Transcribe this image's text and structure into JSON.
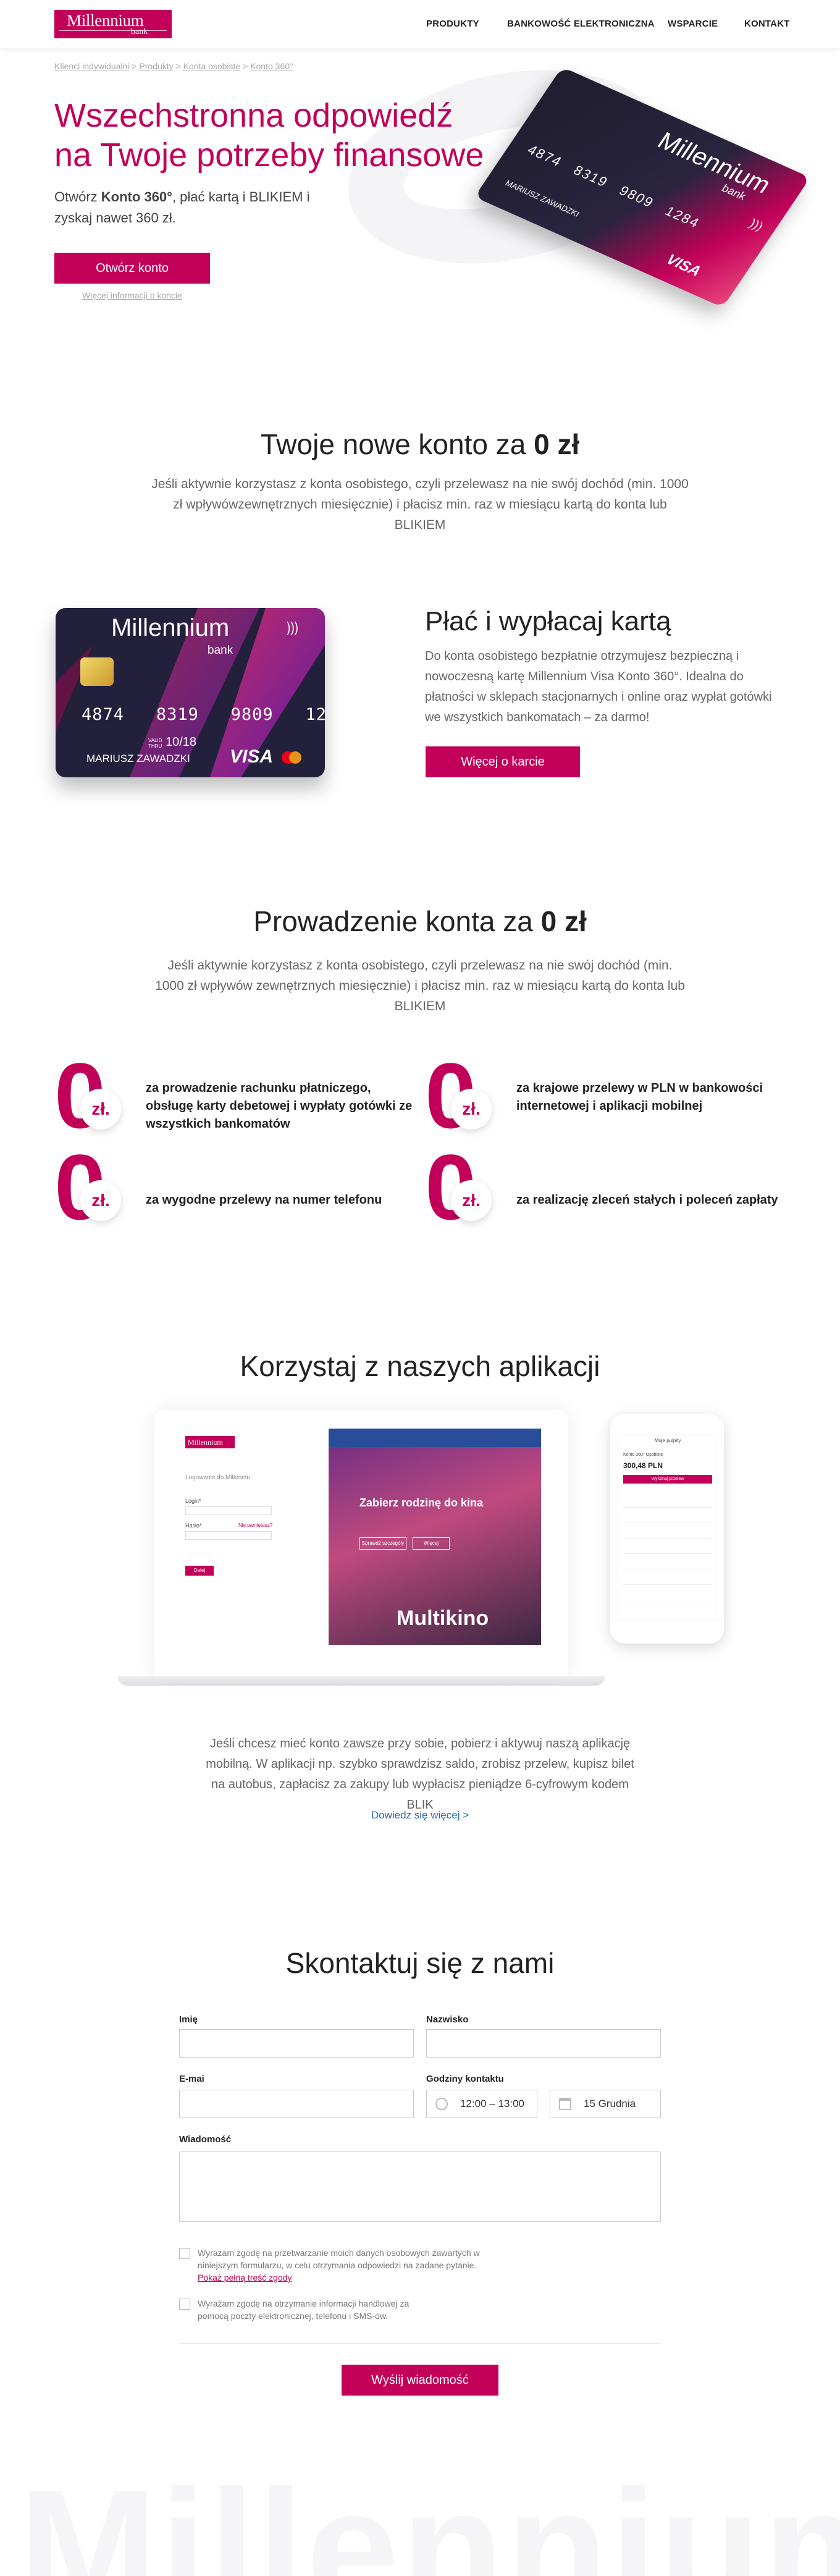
{
  "logo": {
    "name": "Millennium",
    "sub": "bank"
  },
  "nav": {
    "products": "PRODUKTY",
    "ebanking": "BANKOWOŚĆ ELEKTRONICZNA",
    "support": "WSPARCIE",
    "contact": "KONTAKT"
  },
  "breadcrumb": {
    "items": [
      "Klienci indywidualni",
      "Produkty",
      "Konta osobiste",
      "Konto 360°"
    ],
    "sep": " > "
  },
  "hero": {
    "title": "Wszechstronna odpowiedź na Twoje potrzeby finansowe",
    "sub_pre": "Otwórz ",
    "sub_bold": "Konto 360°",
    "sub_post": ", płać kartą i BLIKIEM i zyskaj nawet 360 zł.",
    "cta": "Otwórz konto",
    "more_link": "Więcej informacji o koncie"
  },
  "card": {
    "brand": "Millennium",
    "brand_sub": "bank",
    "number": [
      "4874",
      "8319",
      "9809",
      "1284"
    ],
    "valid_label": "VALID THRU",
    "valid": "10/18",
    "holder": "MARIUSZ ZAWADZKI",
    "network": "VISA"
  },
  "new_account": {
    "title_pre": "Twoje nowe konto za ",
    "title_bold": "0 zł",
    "text": "Jeśli aktywnie korzystasz z konta osobistego, czyli przelewasz na nie swój dochód (min. 1000 zł wpływówzewnętrznych miesięcznie) i płacisz min. raz w miesiącu kartą do konta lub BLIKIEM"
  },
  "pay": {
    "title": "Płać i wypłacaj kartą",
    "text": "Do konta osobistego bezpłatnie otrzymujesz bezpieczną i nowoczesną kartę Millennium Visa Konto 360°. Idealna do płatności w sklepach stacjonarnych i online oraz wypłat gotówki we wszystkich bankomatach – za darmo!",
    "cta": "Więcej o karcie"
  },
  "management": {
    "title_pre": "Prowadzenie konta za ",
    "title_bold": "0 zł",
    "text": "Jeśli aktywnie korzystasz z konta osobistego, czyli przelewasz na nie swój dochód (min. 1000 zł wpływów zewnętrznych miesięcznie) i płacisz min. raz w miesiącu kartą do konta lub BLIKIEM",
    "zero_digit": "0",
    "zero_unit": "zł.",
    "features": [
      "za prowadzenie rachunku płatniczego, obsługę karty debetowej i wypłaty gotówki ze wszystkich bankomatów",
      "za krajowe przelewy w PLN w bankowości internetowej i aplikacji mobilnej",
      "za wygodne przelewy na numer telefonu",
      "za realizację zleceń stałych i poleceń zapłaty"
    ]
  },
  "apps": {
    "title": "Korzystaj z naszych aplikacji",
    "text": "Jeśli chcesz mieć konto zawsze przy sobie, pobierz i aktywuj naszą aplikację mobilną. W aplikacji np. szybko sprawdzisz saldo, zrobisz przelew, kupisz bilet na autobus, zapłacisz za zakupy lub wypłacisz pieniądze 6-cyfrowym kodem BLIK",
    "link": "Dowiedz się więcej >",
    "laptop": {
      "login_title": "Logowanie do Millenetu",
      "login_label": "Login*",
      "password_label": "Hasło*",
      "forgot": "Nie pamiętasz?",
      "login_btn": "Dalej",
      "banner_title": "Zabierz rodzinę do kina",
      "banner_btn1": "Sprawdź szczegóły",
      "banner_btn2": "Więcej",
      "multikino": "Multikino"
    },
    "phone": {
      "header": "Moje pulpity",
      "account": "Konto 360° Osobiste",
      "balance": "300,48 PLN",
      "btn": "Wykonaj przelew"
    }
  },
  "contact": {
    "title": "Skontaktuj się z nami",
    "name_label": "Imię",
    "surname_label": "Nazwisko",
    "email_label": "E-mai",
    "hours_label": "Godziny kontaktu",
    "hours_value": "12:00 – 13:00",
    "date_value": "15 Grudnia",
    "message_label": "Wiadomość",
    "consent1": "Wyrażam zgodę na przetwarzanie moich danych osobowych zawartych w niniejszym formularzu, w celu otrzymania odpowiedzi na zadane pytanie.",
    "consent1_link": "Pokaż pełną treść zgody",
    "consent2": "Wyrażam zgodę na otrzymanie informacji handlowej za pomocą poczty elektronicznej, telefonu i SMS-ów.",
    "submit": "Wyślij wiadomość"
  },
  "watermark": "Millennium",
  "colors": {
    "accent": "#c2005a",
    "link": "#1e6db8"
  },
  "icons": [
    "clock-icon",
    "calendar-icon",
    "contactless-icon",
    "chip-icon",
    "mastercard-icon"
  ]
}
